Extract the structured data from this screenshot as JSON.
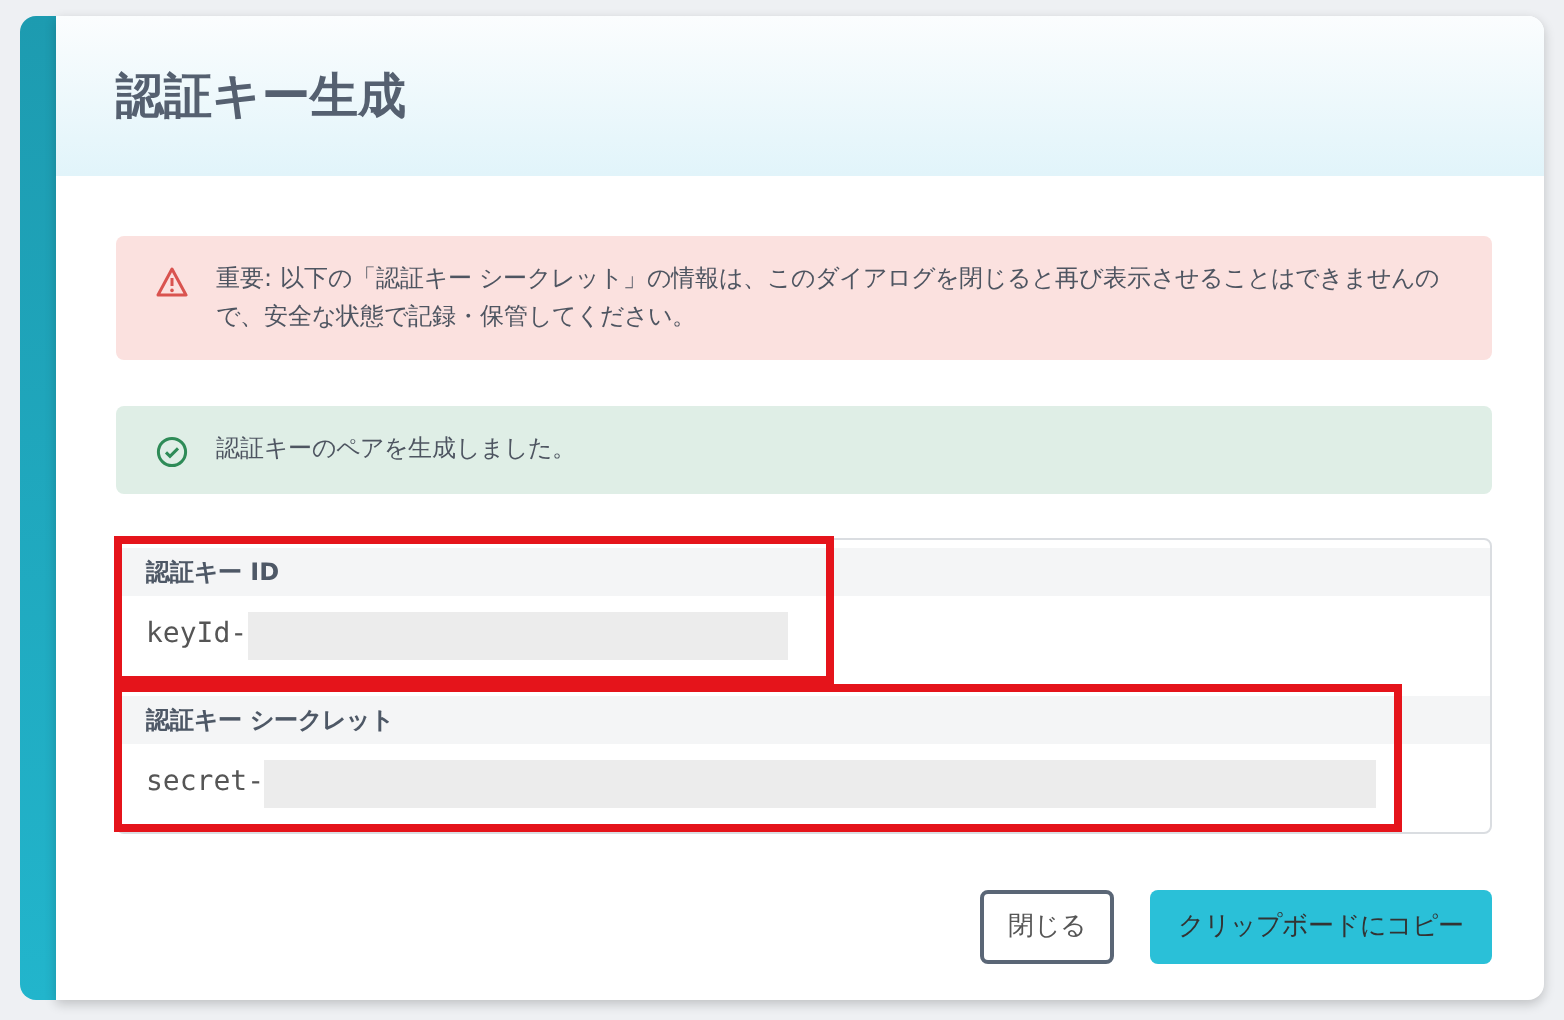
{
  "dialog": {
    "title": "認証キー生成"
  },
  "alerts": [
    {
      "kind": "danger",
      "text": "重要: 以下の「認証キー シークレット」の情報は、このダイアログを閉じると再び表示させることはできませんので、安全な状態で記録・保管してください。"
    },
    {
      "kind": "success",
      "text": "認証キーのペアを生成しました。"
    }
  ],
  "fields": [
    {
      "label": "認証キー ID",
      "value": "keyId-",
      "redacted": true,
      "highlighted": true
    },
    {
      "label": "認証キー シークレット",
      "value": "secret-",
      "redacted": true,
      "highlighted": true
    }
  ],
  "buttons": [
    {
      "kind": "secondary",
      "label": "閉じる"
    },
    {
      "kind": "primary",
      "label": "クリップボードにコピー"
    }
  ]
}
